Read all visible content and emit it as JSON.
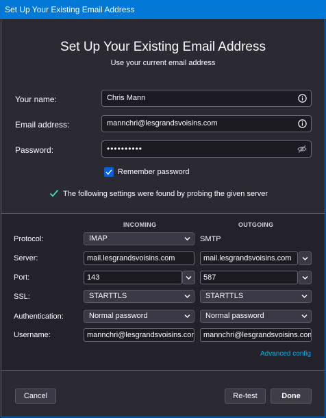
{
  "window": {
    "title": "Set Up Your Existing Email Address"
  },
  "header": {
    "title": "Set Up Your Existing Email Address",
    "subtitle": "Use your current email address"
  },
  "form": {
    "name_label": "Your name:",
    "name_value": "Chris Mann",
    "email_label": "Email address:",
    "email_value": "mannchri@lesgrandsvoisins.com",
    "password_label": "Password:",
    "password_value": "••••••••••",
    "remember_label": "Remember password",
    "remember_checked": true
  },
  "probe": {
    "message": "The following settings were found by probing the given server"
  },
  "settings": {
    "incoming_header": "INCOMING",
    "outgoing_header": "OUTGOING",
    "labels": {
      "protocol": "Protocol:",
      "server": "Server:",
      "port": "Port:",
      "ssl": "SSL:",
      "authentication": "Authentication:",
      "username": "Username:"
    },
    "incoming": {
      "protocol": "IMAP",
      "server": "mail.lesgrandsvoisins.com",
      "port": "143",
      "ssl": "STARTTLS",
      "authentication": "Normal password",
      "username": "mannchri@lesgrandsvoisins.com"
    },
    "outgoing": {
      "protocol": "SMTP",
      "server": "mail.lesgrandsvoisins.com",
      "port": "587",
      "ssl": "STARTTLS",
      "authentication": "Normal password",
      "username": "mannchri@lesgrandsvoisins.com"
    },
    "advanced_link": "Advanced config"
  },
  "buttons": {
    "cancel": "Cancel",
    "retest": "Re-test",
    "done": "Done"
  },
  "colors": {
    "accent": "#0078d7",
    "link": "#00b3f4",
    "success": "#3fe1b0"
  }
}
